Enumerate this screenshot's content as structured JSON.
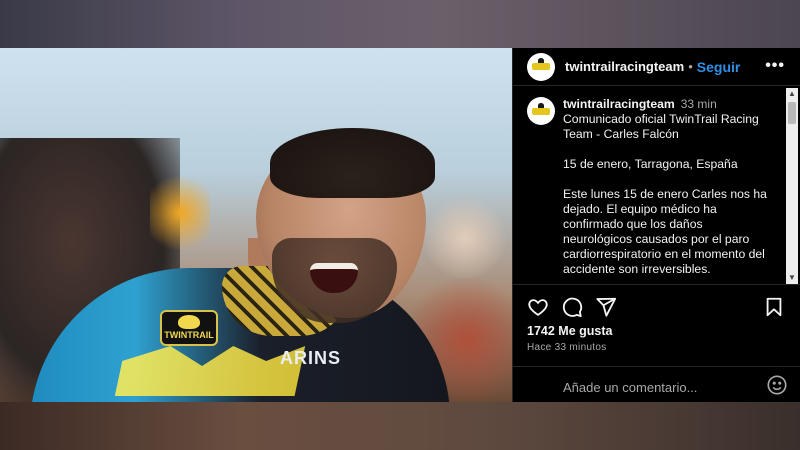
{
  "header": {
    "username": "twintrailracingteam",
    "separator": "•",
    "follow_label": "Seguir",
    "more_icon": "more-horizontal-icon"
  },
  "photo": {
    "badge_text": "TWINTRAIL",
    "jersey_text": "ARINS"
  },
  "caption": {
    "username": "twintrailracingteam",
    "time": "33 min",
    "lines": [
      "Comunicado oficial TwinTrail Racing",
      "Team - Carles Falcón",
      "",
      "15 de enero, Tarragona, España",
      "",
      "Este lunes 15 de enero Carles nos ha",
      "dejado. El equipo médico ha",
      "confirmado que los daños",
      "neurológicos causados por el paro",
      "cardiorrespiratorio en el momento del",
      "accidente son irreversibles."
    ]
  },
  "actions": {
    "like_icon": "heart-icon",
    "comment_icon": "comment-icon",
    "share_icon": "send-icon",
    "save_icon": "bookmark-icon"
  },
  "stats": {
    "likes": "1742 Me gusta",
    "posted_ago": "Hace 33 minutos"
  },
  "comment": {
    "placeholder": "Añade un comentario...",
    "emoji_icon": "smiley-icon"
  },
  "colors": {
    "accent": "#2f8fe6",
    "background": "#000000",
    "text": "#f5f5f5",
    "muted": "#a8a8a8"
  }
}
